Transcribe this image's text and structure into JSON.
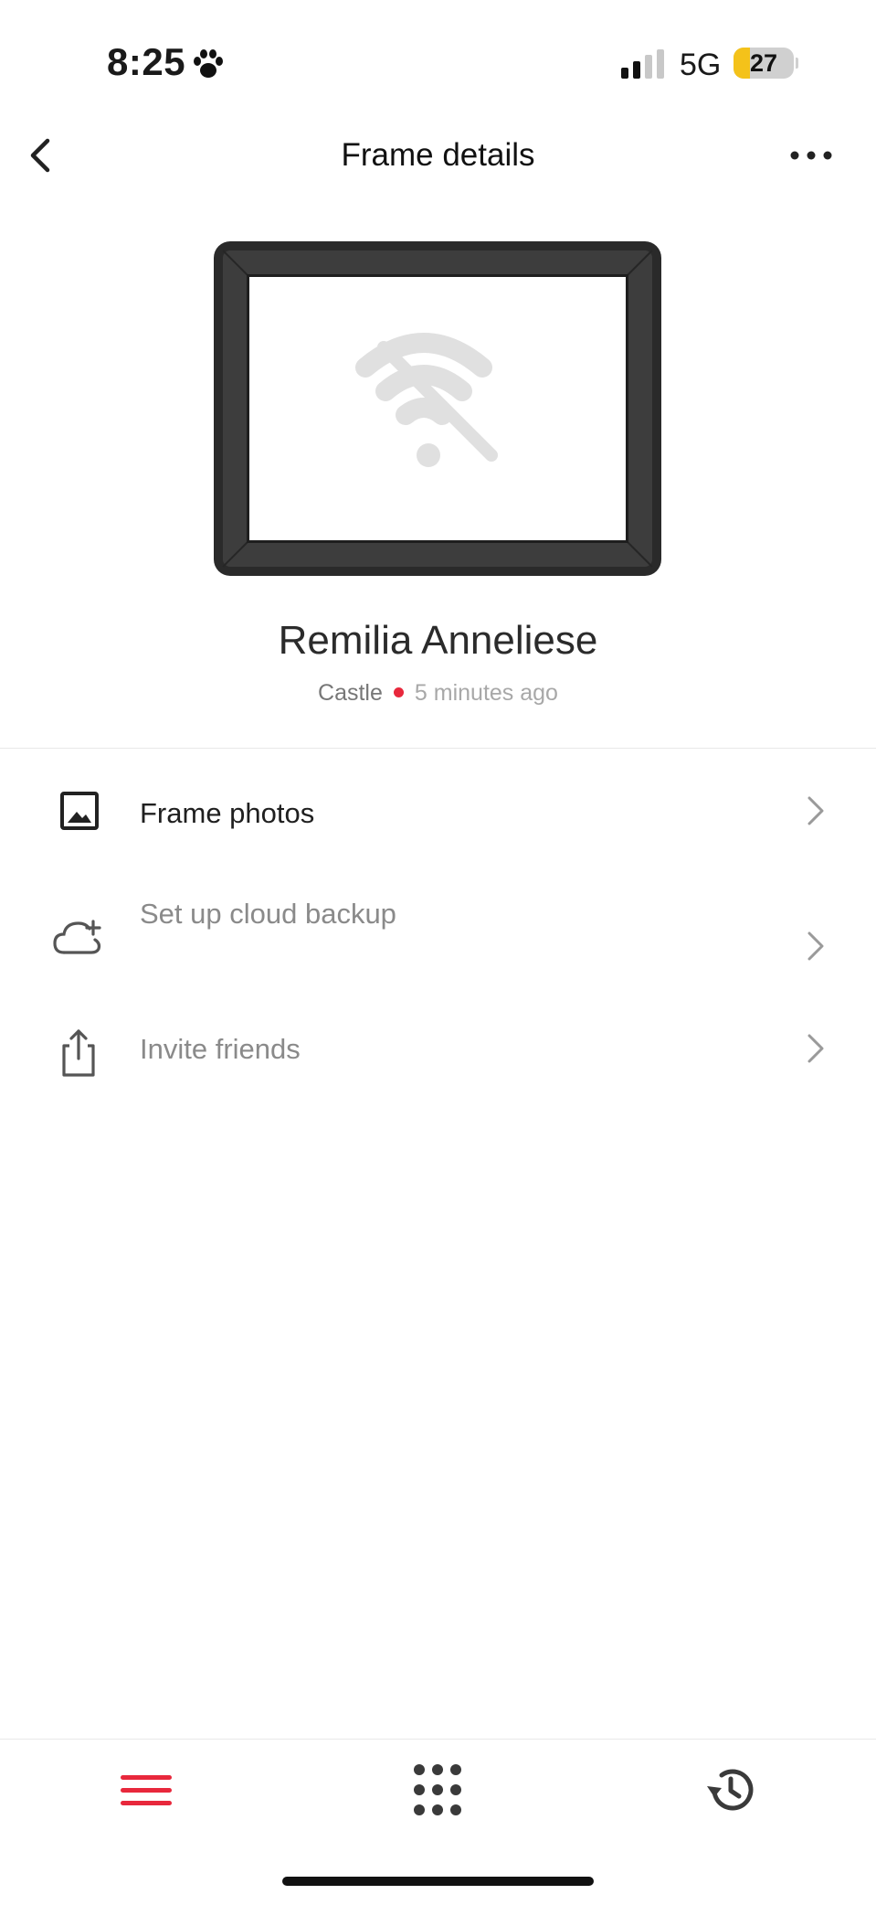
{
  "status_bar": {
    "time": "8:25",
    "network": "5G",
    "battery_level": "27",
    "battery_fraction": 0.27,
    "icons": [
      "paw-icon",
      "cellular-signal-icon",
      "battery-icon"
    ]
  },
  "header": {
    "title": "Frame details",
    "back_icon": "chevron-left-icon",
    "more_icon": "ellipsis-icon"
  },
  "frame": {
    "name": "Remilia Anneliese",
    "location": "Castle",
    "status_color": "#e8283c",
    "last_seen": "5 minutes ago",
    "screen_icon": "wifi-off-icon"
  },
  "menu": [
    {
      "label": "Frame photos",
      "icon": "image-icon",
      "label_color": "#1f1f1f"
    },
    {
      "label": "Set up cloud backup",
      "icon": "cloud-add-icon",
      "label_color": "#8a8a8a"
    },
    {
      "label": "Invite friends",
      "icon": "share-icon",
      "label_color": "#8a8a8a"
    }
  ],
  "tabbar": {
    "tabs": [
      {
        "icon": "menu-icon",
        "color": "#e8283c",
        "active": true
      },
      {
        "icon": "grid-icon",
        "color": "#3a3a3a",
        "active": false
      },
      {
        "icon": "history-icon",
        "color": "#3a3a3a",
        "active": false
      }
    ]
  },
  "colors": {
    "accent": "#e8283c",
    "frame_border": "#2a2a2a",
    "frame_bevel": "#404040"
  }
}
